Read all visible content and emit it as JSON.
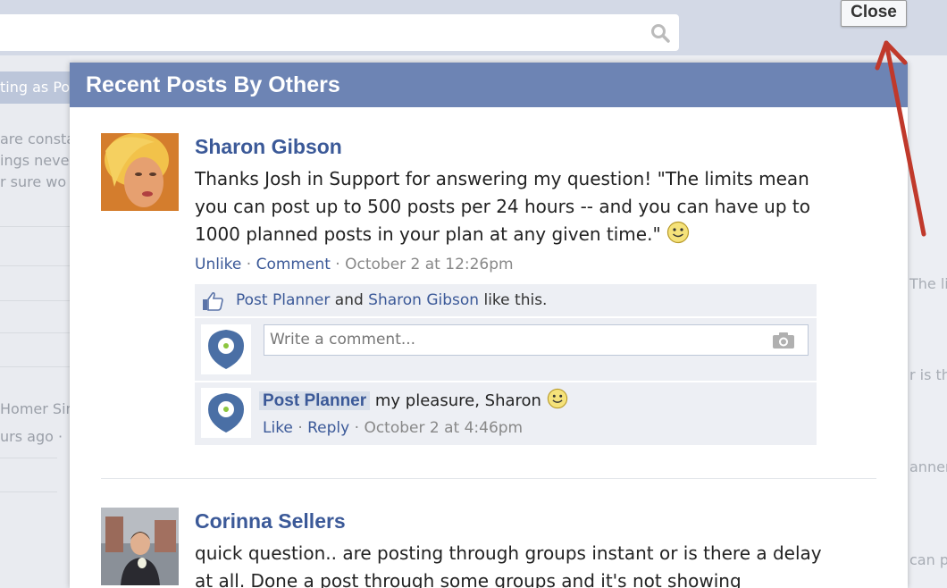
{
  "background": {
    "sidebar_strip_text": "ting as Po",
    "left_snippets": [
      "are consta",
      "ings neve",
      "r sure wo",
      "Homer Sin",
      "urs ago ·"
    ],
    "right_snippets": [
      "The lin",
      "r is th",
      "anner",
      "can po"
    ]
  },
  "close_button": "Close",
  "dialog": {
    "title": "Recent Posts By Others",
    "posts": [
      {
        "author": "Sharon Gibson",
        "text": "Thanks Josh in Support for answering my question! \"The limits mean you can post up to 500 posts per 24 hours -- and you can have up to 1000 planned posts in your plan at any given time.\"",
        "actions": {
          "unlike": "Unlike",
          "comment": "Comment",
          "sep": "·",
          "time": "October 2 at 12:26pm"
        },
        "likes": {
          "liker1": "Post Planner",
          "and": "and",
          "liker2": "Sharon Gibson",
          "suffix": "like this."
        },
        "comment_placeholder": "Write a comment...",
        "reply": {
          "author": "Post Planner",
          "text": "my pleasure, Sharon",
          "like": "Like",
          "reply": "Reply",
          "sep": "·",
          "time": "October 2 at 4:46pm"
        }
      },
      {
        "author": "Corinna Sellers",
        "text": "quick question.. are posting through groups instant or is there a delay at all. Done a post through some groups and it's not showing"
      }
    ]
  },
  "colors": {
    "header": "#6d84b4",
    "link": "#3b5998",
    "ufi_bg": "#edeff4",
    "arrow": "#c0392b"
  }
}
